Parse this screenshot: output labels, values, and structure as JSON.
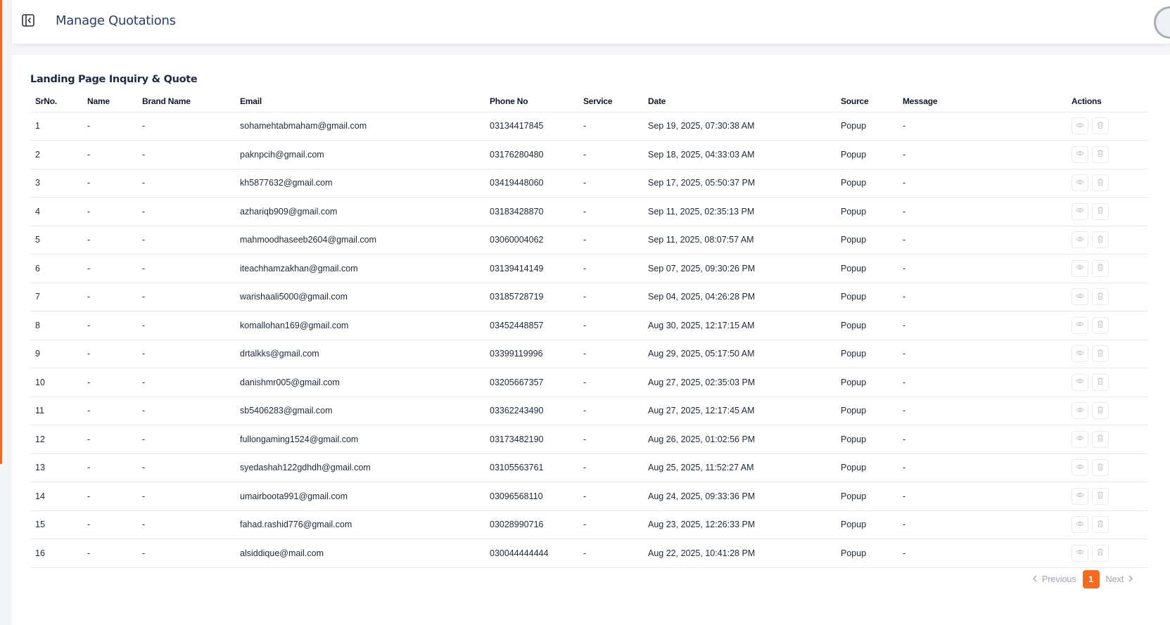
{
  "header": {
    "title": "Manage Quotations"
  },
  "section": {
    "title": "Landing Page Inquiry & Quote"
  },
  "table": {
    "columns": [
      "SrNo.",
      "Name",
      "Brand Name",
      "Email",
      "Phone No",
      "Service",
      "Date",
      "Source",
      "Message",
      "Actions"
    ],
    "rows": [
      {
        "sr": "1",
        "name": "-",
        "brand": "-",
        "email": "sohamehtabmaham@gmail.com",
        "phone": "03134417845",
        "service": "-",
        "date": "Sep 19, 2025, 07:30:38 AM",
        "source": "Popup",
        "message": "-"
      },
      {
        "sr": "2",
        "name": "-",
        "brand": "-",
        "email": "paknpcih@gmail.com",
        "phone": "03176280480",
        "service": "-",
        "date": "Sep 18, 2025, 04:33:03 AM",
        "source": "Popup",
        "message": "-"
      },
      {
        "sr": "3",
        "name": "-",
        "brand": "-",
        "email": "kh5877632@gmail.com",
        "phone": "03419448060",
        "service": "-",
        "date": "Sep 17, 2025, 05:50:37 PM",
        "source": "Popup",
        "message": "-"
      },
      {
        "sr": "4",
        "name": "-",
        "brand": "-",
        "email": "azhariqb909@gmail.com",
        "phone": "03183428870",
        "service": "-",
        "date": "Sep 11, 2025, 02:35:13 PM",
        "source": "Popup",
        "message": "-"
      },
      {
        "sr": "5",
        "name": "-",
        "brand": "-",
        "email": "mahmoodhaseeb2604@gmail.com",
        "phone": "03060004062",
        "service": "-",
        "date": "Sep 11, 2025, 08:07:57 AM",
        "source": "Popup",
        "message": "-"
      },
      {
        "sr": "6",
        "name": "-",
        "brand": "-",
        "email": "iteachhamzakhan@gmail.com",
        "phone": "03139414149",
        "service": "-",
        "date": "Sep 07, 2025, 09:30:26 PM",
        "source": "Popup",
        "message": "-"
      },
      {
        "sr": "7",
        "name": "-",
        "brand": "-",
        "email": "warishaali5000@gmail.com",
        "phone": "03185728719",
        "service": "-",
        "date": "Sep 04, 2025, 04:26:28 PM",
        "source": "Popup",
        "message": "-"
      },
      {
        "sr": "8",
        "name": "-",
        "brand": "-",
        "email": "komallohan169@gmail.com",
        "phone": "03452448857",
        "service": "-",
        "date": "Aug 30, 2025, 12:17:15 AM",
        "source": "Popup",
        "message": "-"
      },
      {
        "sr": "9",
        "name": "-",
        "brand": "-",
        "email": "drtalkks@gmail.com",
        "phone": "03399119996",
        "service": "-",
        "date": "Aug 29, 2025, 05:17:50 AM",
        "source": "Popup",
        "message": "-"
      },
      {
        "sr": "10",
        "name": "-",
        "brand": "-",
        "email": "danishmr005@gmail.com",
        "phone": "03205667357",
        "service": "-",
        "date": "Aug 27, 2025, 02:35:03 PM",
        "source": "Popup",
        "message": "-"
      },
      {
        "sr": "11",
        "name": "-",
        "brand": "-",
        "email": "sb5406283@gmail.com",
        "phone": "03362243490",
        "service": "-",
        "date": "Aug 27, 2025, 12:17:45 AM",
        "source": "Popup",
        "message": "-"
      },
      {
        "sr": "12",
        "name": "-",
        "brand": "-",
        "email": "fullongaming1524@gmail.com",
        "phone": "03173482190",
        "service": "-",
        "date": "Aug 26, 2025, 01:02:56 PM",
        "source": "Popup",
        "message": "-"
      },
      {
        "sr": "13",
        "name": "-",
        "brand": "-",
        "email": "syedashah122gdhdh@gmail.com",
        "phone": "03105563761",
        "service": "-",
        "date": "Aug 25, 2025, 11:52:27 AM",
        "source": "Popup",
        "message": "-"
      },
      {
        "sr": "14",
        "name": "-",
        "brand": "-",
        "email": "umairboota991@gmail.com",
        "phone": "03096568110",
        "service": "-",
        "date": "Aug 24, 2025, 09:33:36 PM",
        "source": "Popup",
        "message": "-"
      },
      {
        "sr": "15",
        "name": "-",
        "brand": "-",
        "email": "fahad.rashid776@gmail.com",
        "phone": "03028990716",
        "service": "-",
        "date": "Aug 23, 2025, 12:26:33 PM",
        "source": "Popup",
        "message": "-"
      },
      {
        "sr": "16",
        "name": "-",
        "brand": "-",
        "email": "alsiddique@mail.com",
        "phone": "030044444444",
        "service": "-",
        "date": "Aug 22, 2025, 10:41:28 PM",
        "source": "Popup",
        "message": "-"
      }
    ],
    "row_actions": [
      "eye-icon",
      "trash-icon"
    ]
  },
  "pagination": {
    "previous": "Previous",
    "current": "1",
    "next": "Next"
  },
  "colors": {
    "accent": "#f26b21",
    "title": "#2c3e63",
    "border": "#e5e7eb",
    "muted": "#9ca3af"
  }
}
